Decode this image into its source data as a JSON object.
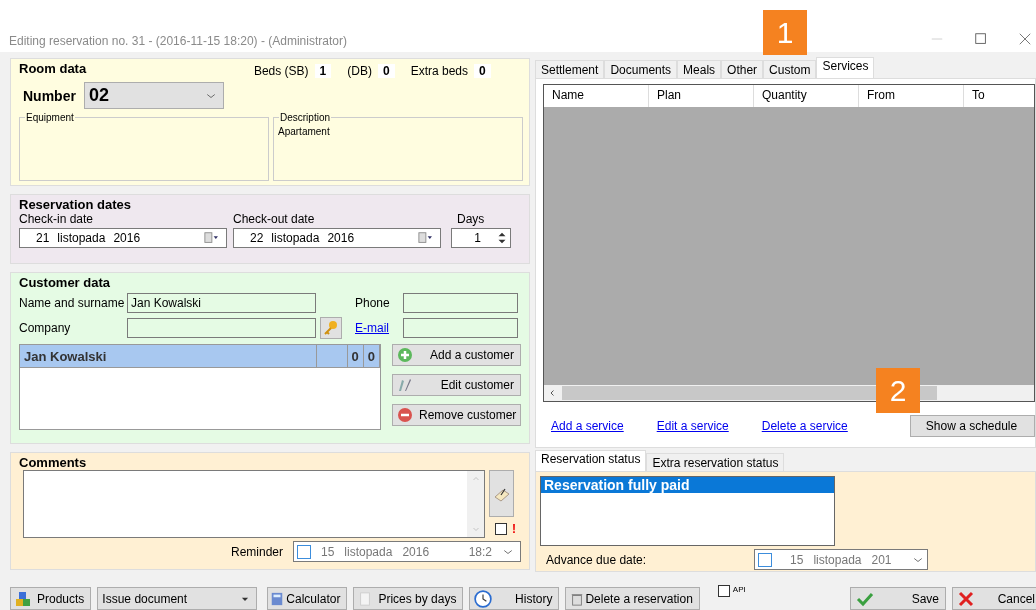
{
  "window": {
    "title": "Editing reservation no. 31 - (2016-11-15 18:20) - (Administrator)"
  },
  "callouts": [
    "1",
    "2"
  ],
  "room_data": {
    "title": "Room data",
    "number_label": "Number",
    "number_value": "02",
    "beds": [
      {
        "label": "Beds (SB)",
        "value": "1"
      },
      {
        "label": "(DB)",
        "value": "0"
      },
      {
        "label": "Extra beds",
        "value": "0"
      }
    ],
    "equipment": {
      "label": "Equipment"
    },
    "description": {
      "label": "Description",
      "value": "Apartament"
    }
  },
  "reservation_dates": {
    "title": "Reservation dates",
    "check_in": {
      "label": "Check-in date",
      "day": "21",
      "month": "listopada",
      "year": "2016"
    },
    "check_out": {
      "label": "Check-out date",
      "day": "22",
      "month": "listopada",
      "year": "2016"
    },
    "days": {
      "label": "Days",
      "value": "1"
    }
  },
  "customer_data": {
    "title": "Customer data",
    "name": {
      "label": "Name and surname",
      "value": "Jan Kowalski"
    },
    "company": {
      "label": "Company"
    },
    "phone": {
      "label": "Phone"
    },
    "email": {
      "label": "E-mail"
    },
    "customers": [
      {
        "name": "Jan Kowalski",
        "column_3": "0",
        "column_4": "0",
        "selected": true
      }
    ],
    "buttons": [
      {
        "label": "Add a customer",
        "kind": "add"
      },
      {
        "label": "Edit customer",
        "kind": "edit"
      },
      {
        "label": "Remove customer",
        "kind": "remove"
      }
    ]
  },
  "comments": {
    "title": "Comments",
    "flag_checked": false,
    "flag_mark": "!",
    "reminder": {
      "label": "Reminder",
      "checked": false,
      "day": "15",
      "month": "listopada",
      "year": "2016",
      "time": "18:2"
    }
  },
  "tabs": [
    {
      "label": "Settlement",
      "selected": false
    },
    {
      "label": "Documents",
      "selected": false
    },
    {
      "label": "Meals",
      "selected": false
    },
    {
      "label": "Other",
      "selected": false
    },
    {
      "label": "Custom",
      "selected": false
    },
    {
      "label": "Services",
      "selected": true
    }
  ],
  "services": {
    "columns": [
      "Name",
      "Plan",
      "Quantity",
      "From",
      "To"
    ],
    "links": [
      "Add a service",
      "Edit a service",
      "Delete a service"
    ],
    "schedule_button": "Show a schedule"
  },
  "status_tabs": [
    {
      "label": "Reservation status",
      "selected": true
    },
    {
      "label": "Extra reservation status",
      "selected": false
    }
  ],
  "statuses": [
    {
      "label": "Reservation fully paid",
      "selected": true
    }
  ],
  "advance_due_date": {
    "label": "Advance due date:",
    "checked": false,
    "day": "15",
    "month": "listopada",
    "year": "201"
  },
  "toolbar": {
    "products": "Products",
    "issue_document": "Issue document",
    "calculator": "Calculator",
    "prices_by_days": "Prices by days",
    "history": "History",
    "delete": "Delete a reservation",
    "api": {
      "label": "API",
      "checked": false
    },
    "save": "Save",
    "cancel": "Cancel"
  }
}
